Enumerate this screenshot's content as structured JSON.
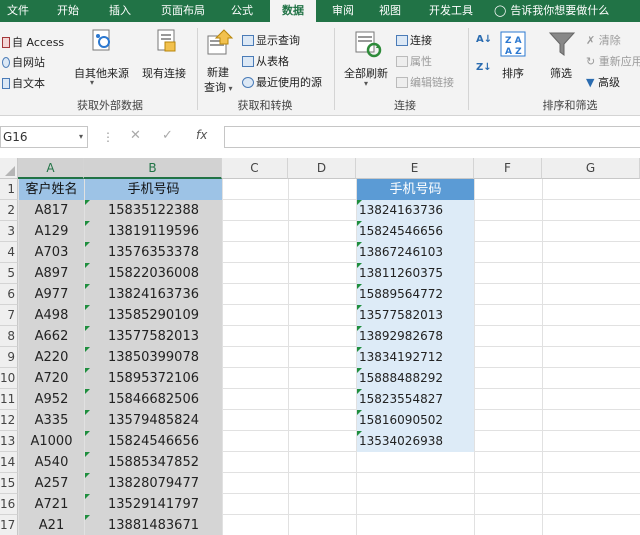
{
  "tabs": [
    "文件",
    "开始",
    "插入",
    "页面布局",
    "公式",
    "数据",
    "审阅",
    "视图",
    "开发工具"
  ],
  "active_tab": "数据",
  "tell_me": "告诉我你想要做什么",
  "ribbon": {
    "get_external": {
      "access": "自 Access",
      "web": "自网站",
      "text": "自文本",
      "other": "自其他来源",
      "existing": "现有连接",
      "label": "获取外部数据"
    },
    "transform": {
      "new_query": "新建",
      "new_query2": "查询",
      "show_queries": "显示查询",
      "from_table": "从表格",
      "recent_sources": "最近使用的源",
      "label": "获取和转换"
    },
    "connections": {
      "refresh_all": "全部刷新",
      "connections": "连接",
      "properties": "属性",
      "edit_links": "编辑链接",
      "label": "连接"
    },
    "sort_filter": {
      "sort": "排序",
      "filter": "筛选",
      "clear": "清除",
      "reapply": "重新应用",
      "advanced": "高级",
      "label": "排序和筛选"
    }
  },
  "namebox": "G16",
  "columns": [
    "A",
    "B",
    "C",
    "D",
    "E",
    "F",
    "G"
  ],
  "row_numbers": [
    "1",
    "2",
    "3",
    "4",
    "5",
    "6",
    "7",
    "8",
    "9",
    "10",
    "11",
    "12",
    "13",
    "14",
    "15",
    "16",
    "17"
  ],
  "table_headers": {
    "a": "客户姓名",
    "b": "手机号码",
    "e": "手机号码"
  },
  "col_a": [
    "A817",
    "A129",
    "A703",
    "A897",
    "A977",
    "A498",
    "A662",
    "A220",
    "A720",
    "A952",
    "A335",
    "A1000",
    "A540",
    "A257",
    "A721",
    "A21"
  ],
  "col_b": [
    "15835122388",
    "13819119596",
    "13576353378",
    "15822036008",
    "13824163736",
    "13585290109",
    "13577582013",
    "13850399078",
    "15895372106",
    "15846682506",
    "13579485824",
    "15824546656",
    "15885347852",
    "13828079477",
    "13529141797",
    "13881483671"
  ],
  "col_e": [
    "13824163736",
    "15824546656",
    "13867246103",
    "13811260375",
    "15889564772",
    "13577582013",
    "13892982678",
    "13834192712",
    "15888488292",
    "15823554827",
    "15816090502",
    "13534026938"
  ],
  "colors": {
    "excel_green": "#217346",
    "header_blue": "#5b9bd5",
    "light_blue": "#ddebf7",
    "selection_gray": "#d5d5d5"
  }
}
